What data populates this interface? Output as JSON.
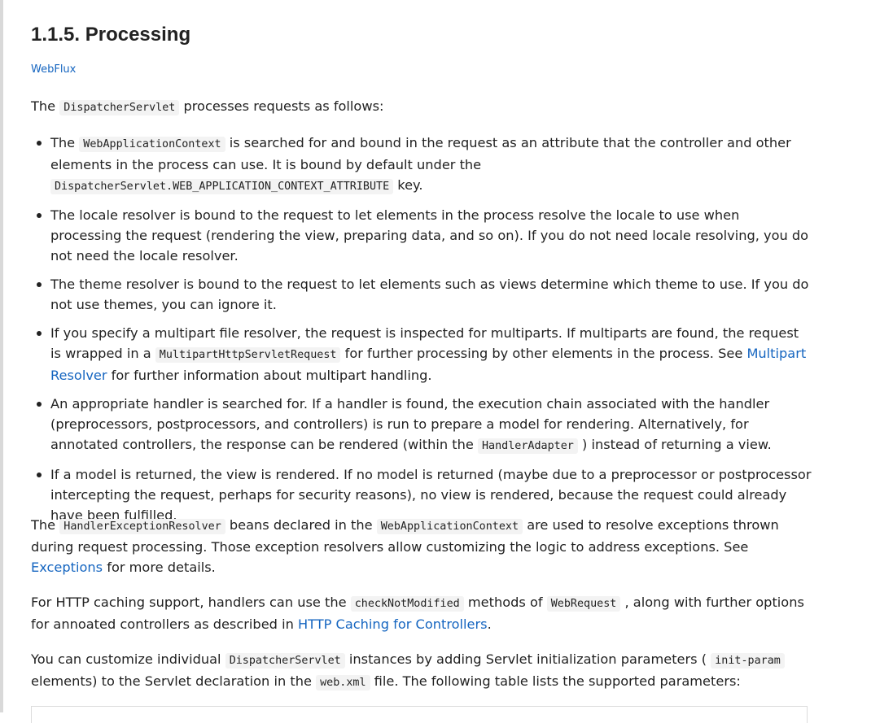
{
  "heading": "1.1.5. Processing",
  "webflux_link": "WebFlux",
  "intro": {
    "p1": "The ",
    "code": "DispatcherServlet",
    "p2": " processes requests as follows:"
  },
  "items": [
    {
      "t1": "The ",
      "c1": "WebApplicationContext",
      "t2": " is searched for and bound in the request as an attribute that the controller and other elements in the process can use. It is bound by default under the ",
      "c2": "DispatcherServlet.WEB_APPLICATION_CONTEXT_ATTRIBUTE",
      "t3": " key."
    },
    {
      "t1": "The locale resolver is bound to the request to let elements in the process resolve the locale to use when processing the request (rendering the view, preparing data, and so on). If you do not need locale resolving, you do not need the locale resolver."
    },
    {
      "t1": "The theme resolver is bound to the request to let elements such as views determine which theme to use. If you do not use themes, you can ignore it."
    },
    {
      "t1": "If you specify a multipart file resolver, the request is inspected for multiparts. If multiparts are found, the request is wrapped in a ",
      "c1": "MultipartHttpServletRequest",
      "t2": " for further processing by other elements in the process. See ",
      "link": "Multipart Resolver",
      "t3": " for further information about multipart handling."
    },
    {
      "t1": "An appropriate handler is searched for. If a handler is found, the execution chain associated with the handler (preprocessors, postprocessors, and controllers) is run to prepare a model for rendering. Alternatively, for annotated controllers, the response can be rendered (within the ",
      "c1": "HandlerAdapter",
      "t2": " ) instead of returning a view."
    },
    {
      "t1": "If a model is returned, the view is rendered. If no model is returned (maybe due to a preprocessor or postprocessor intercepting the request, perhaps for security reasons), no view is rendered, because the request could already have been fulfilled."
    }
  ],
  "para_exceptions": {
    "t1": "The ",
    "c1": "HandlerExceptionResolver",
    "t2": " beans declared in the ",
    "c2": "WebApplicationContext",
    "t3": " are used to resolve exceptions thrown during request processing. Those exception resolvers allow customizing the logic to address exceptions. See ",
    "link": "Exceptions",
    "t4": " for more details."
  },
  "para_caching": {
    "t1": "For HTTP caching support, handlers can use the ",
    "c1": "checkNotModified",
    "t2": " methods of ",
    "c2": "WebRequest",
    "t3": " , along with further options for annoated controllers as described in ",
    "link": "HTTP Caching for Controllers",
    "t4": "."
  },
  "para_customize": {
    "t1": "You can customize individual ",
    "c1": "DispatcherServlet",
    "t2": " instances by adding Servlet initialization parameters ( ",
    "c2": "init-param",
    "t3": " elements) to the Servlet declaration in the ",
    "c3": "web.xml",
    "t4": " file. The following table lists the supported parameters:"
  }
}
